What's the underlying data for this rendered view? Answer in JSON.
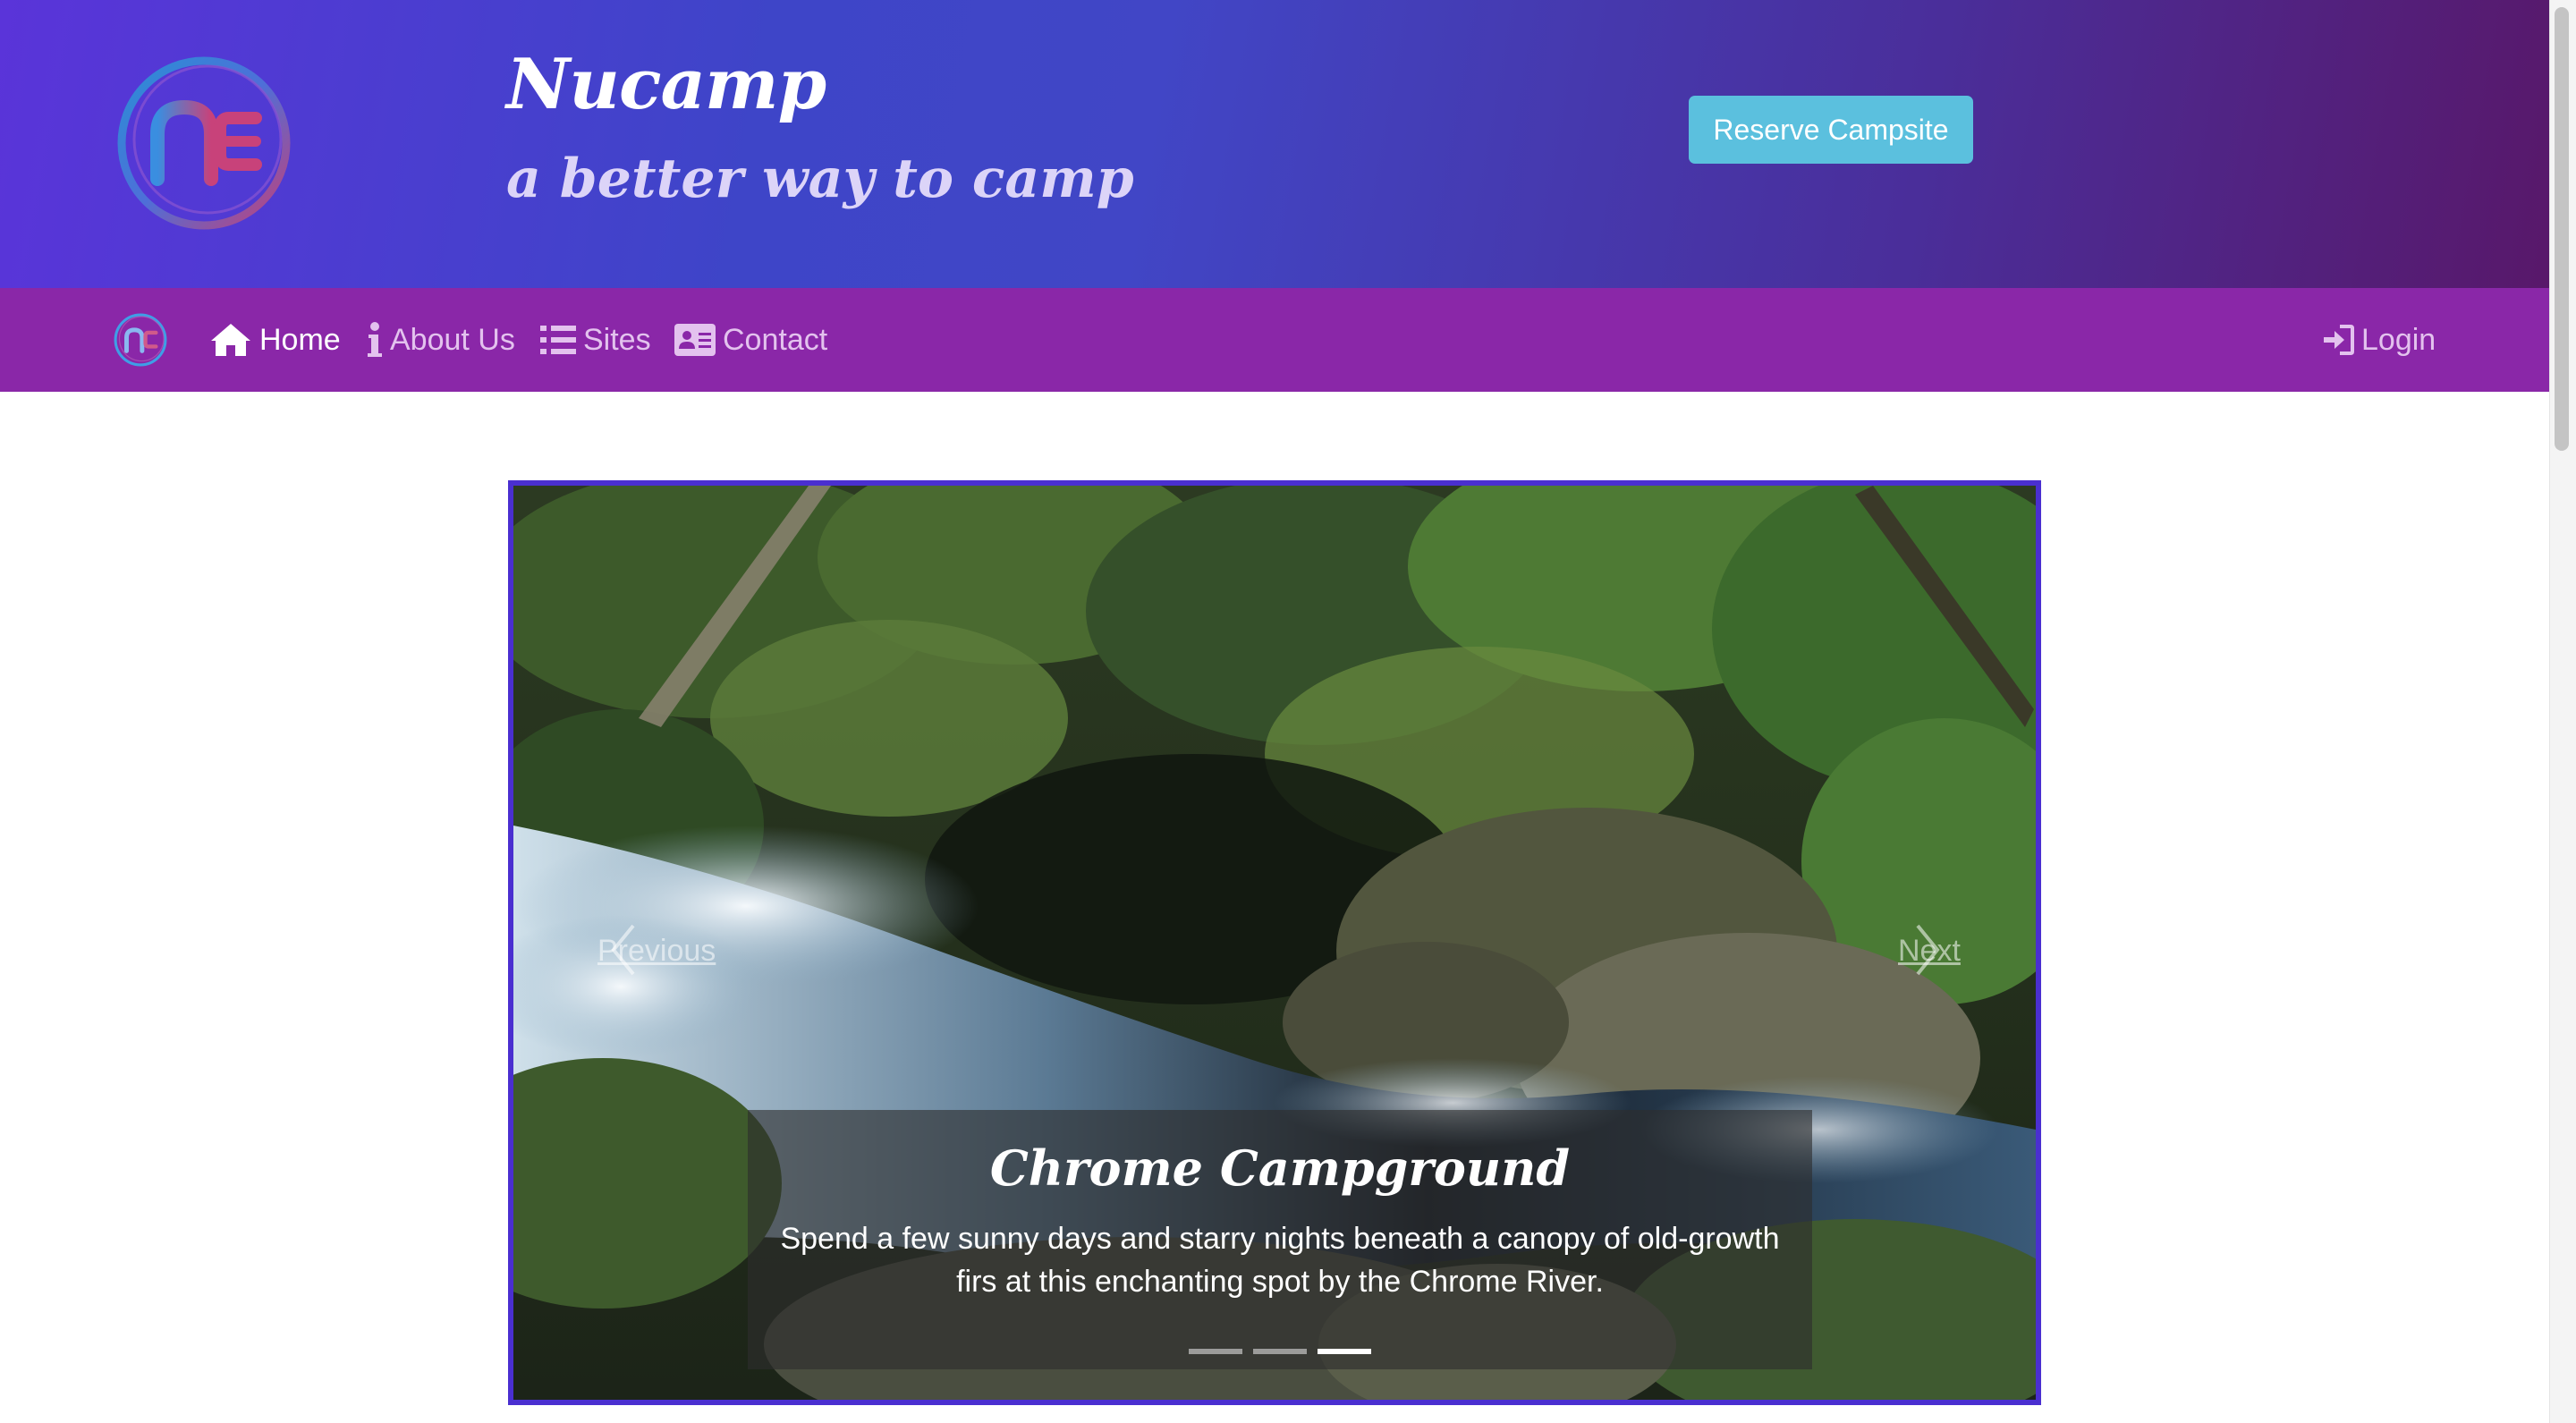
{
  "header": {
    "title": "Nucamp",
    "tagline": "a better way to camp",
    "reserve_label": "Reserve Campsite"
  },
  "navbar": {
    "items": [
      {
        "label": "Home",
        "icon": "home-icon",
        "active": true
      },
      {
        "label": "About Us",
        "icon": "info-icon",
        "active": false
      },
      {
        "label": "Sites",
        "icon": "list-icon",
        "active": false
      },
      {
        "label": "Contact",
        "icon": "address-card-icon",
        "active": false
      }
    ],
    "login_label": "Login",
    "login_icon": "sign-in-icon"
  },
  "carousel": {
    "prev_label": "Previous",
    "next_label": "Next",
    "caption_title": "Chrome Campground",
    "caption_text": "Spend a few sunny days and starry nights beneath a canopy of old-growth firs at this enchanting spot by the Chrome River.",
    "slide_count": 3,
    "active_slide": 3
  },
  "colors": {
    "header_gradient_start": "#5a34d9",
    "header_gradient_end": "#58186a",
    "navbar": "#8a27a8",
    "reserve_button": "#5bc0de",
    "carousel_border": "#4a2fd0"
  }
}
